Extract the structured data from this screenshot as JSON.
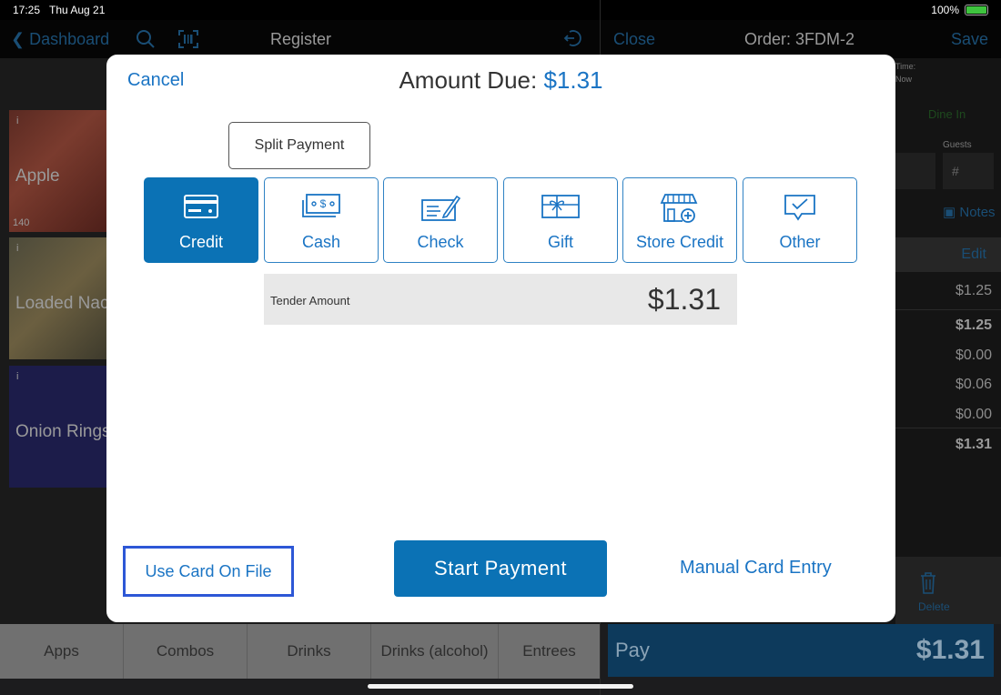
{
  "status_bar": {
    "time": "17:25",
    "date": "Thu Aug 21",
    "battery": "100%"
  },
  "register_bar": {
    "back_label": "Dashboard",
    "title": "Register"
  },
  "order_bar": {
    "close_label": "Close",
    "title": "Order: 3FDM-2",
    "save_label": "Save"
  },
  "products": [
    {
      "name": "Apple",
      "count": "140"
    },
    {
      "name": "Loaded Nachos"
    },
    {
      "name": "Onion Rings"
    }
  ],
  "order_panel": {
    "time_label": "Time:",
    "time_value": "Now",
    "dine_in": "Dine In",
    "guests_label": "Guests",
    "guests_placeholder": "#",
    "notes_label": "Notes",
    "edit_label": "Edit",
    "values": [
      "$1.25",
      "$1.25",
      "$0.00",
      "$0.06",
      "$0.00",
      "$1.31"
    ],
    "delete_label": "Delete"
  },
  "categories": [
    "Apps",
    "Combos",
    "Drinks",
    "Drinks (alcohol)",
    "Entrees"
  ],
  "pay_bar": {
    "label": "Pay",
    "amount": "$1.31"
  },
  "modal": {
    "cancel_label": "Cancel",
    "title_prefix": "Amount Due:",
    "amount_due": "$1.31",
    "split_payment_label": "Split Payment",
    "tender_types": [
      {
        "label": "Credit",
        "icon": "credit-card-icon",
        "selected": true
      },
      {
        "label": "Cash",
        "icon": "cash-icon",
        "selected": false
      },
      {
        "label": "Check",
        "icon": "check-icon",
        "selected": false
      },
      {
        "label": "Gift",
        "icon": "gift-card-icon",
        "selected": false
      },
      {
        "label": "Store Credit",
        "icon": "store-icon",
        "selected": false
      },
      {
        "label": "Other",
        "icon": "chat-check-icon",
        "selected": false
      }
    ],
    "tender_amount_label": "Tender Amount",
    "tender_amount_value": "$1.31",
    "use_card_on_file_label": "Use Card On File",
    "start_payment_label": "Start Payment",
    "manual_card_entry_label": "Manual Card Entry"
  },
  "colors": {
    "accent": "#0b72b5",
    "link": "#1a74c4",
    "highlight_border": "#2d57d6"
  }
}
